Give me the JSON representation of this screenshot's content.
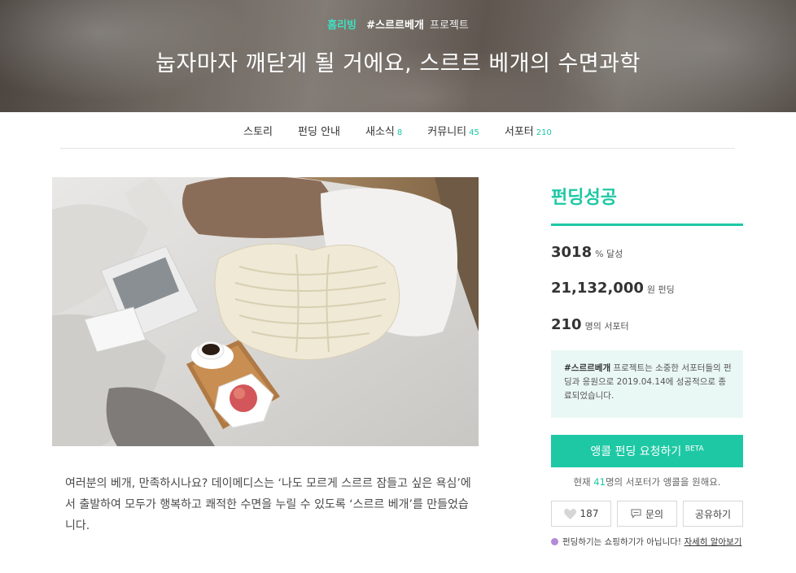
{
  "hero": {
    "category": "홈리빙",
    "hashtag": "#스르르베개",
    "project_word": "프로젝트",
    "title": "눕자마자 깨닫게 될 거에요, 스르르 베개의 수면과학"
  },
  "nav": [
    {
      "label": "스토리",
      "count": ""
    },
    {
      "label": "펀딩 안내",
      "count": ""
    },
    {
      "label": "새소식",
      "count": "8"
    },
    {
      "label": "커뮤니티",
      "count": "45"
    },
    {
      "label": "서포터",
      "count": "210"
    }
  ],
  "story": {
    "text": "여러분의 베개, 만족하시나요? 데이메디스는 ‘나도 모르게 스르르 잠들고 싶은 욕심’에서 출발하여 모두가 행복하고 쾌적한 수면을 누릴 수 있도록 ‘스르르 베개’를 만들었습니다."
  },
  "sidebar": {
    "status": "펀딩성공",
    "percent": "3018",
    "percent_unit": "% 달성",
    "amount": "21,132,000",
    "amount_unit": "원 펀딩",
    "supporters": "210",
    "supporters_unit": "명의 서포터",
    "notice_hash": "#스르르베개",
    "notice_text": "프로젝트는 소중한 서포터들의 펀딩과 응원으로 2019.04.14에 성공적으로 종료되었습니다.",
    "encore_label": "앵콜 펀딩 요청하기",
    "encore_badge": "BETA",
    "encore_prefix": "현재",
    "encore_count": "41",
    "encore_suffix": "명의 서포터가 앵콜을 원해요.",
    "like_count": "187",
    "inquiry_label": "문의",
    "share_label": "공유하기",
    "disclaimer": "펀딩하기는 쇼핑하기가 아닙니다!",
    "learn_more": "자세히 알아보기"
  },
  "colors": {
    "accent": "#1ec8a5",
    "notice_bg": "#eaf8f5",
    "disclaimer_dot": "#b48bd6"
  },
  "icons": [
    "heart-icon",
    "chat-icon",
    "info-dot-icon"
  ]
}
